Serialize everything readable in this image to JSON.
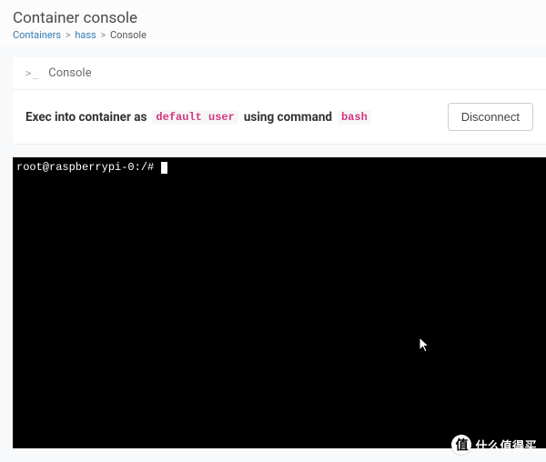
{
  "header": {
    "title": "Container console",
    "breadcrumb": {
      "link1": "Containers",
      "link2": "hass",
      "current": "Console"
    }
  },
  "panel": {
    "header_label": "Console",
    "prompt_icon": ">_"
  },
  "exec": {
    "prefix": "Exec into container as",
    "user": "default user",
    "middle": "using command",
    "command": "bash",
    "disconnect_label": "Disconnect"
  },
  "terminal": {
    "prompt": "root@raspberrypi-0:/#"
  },
  "watermark": {
    "badge": "值",
    "text": "什么值得买"
  }
}
